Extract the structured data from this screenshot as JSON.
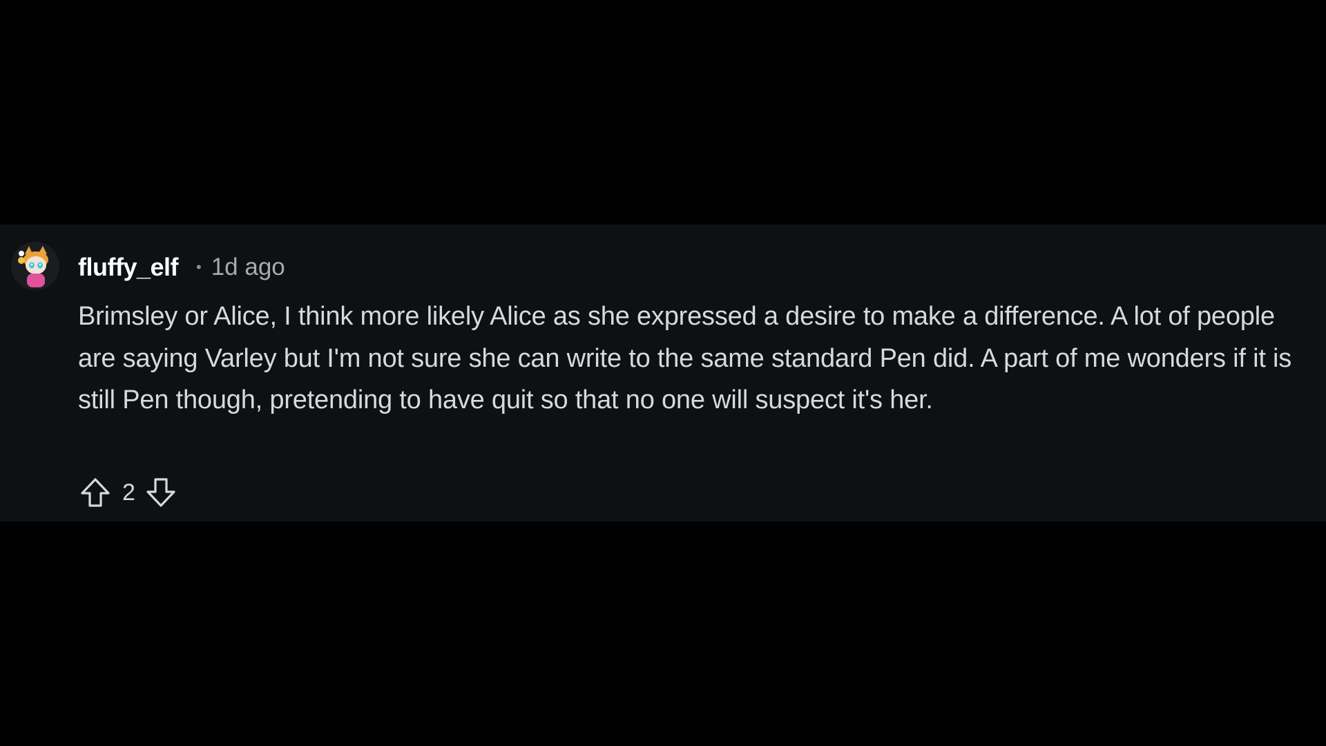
{
  "comment": {
    "username": "fluffy_elf",
    "separator": "•",
    "timestamp": "1d ago",
    "body": "Brimsley or Alice, I think more likely Alice as she expressed a desire to make a difference. A lot of people are saying Varley but I'm not sure she can write to the same standard Pen did. A part of me wonders if it is still Pen though, pretending to have quit so that no one will suspect it's her.",
    "score": "2",
    "avatar_icon": "avatar-icon",
    "upvote_icon": "arrow-up-outline-icon",
    "downvote_icon": "arrow-down-outline-icon"
  },
  "colors": {
    "page_background": "#000000",
    "card_background": "#0e1113",
    "text_primary": "#d7dadc",
    "username": "#ffffff",
    "meta_text": "#a8aaab"
  }
}
